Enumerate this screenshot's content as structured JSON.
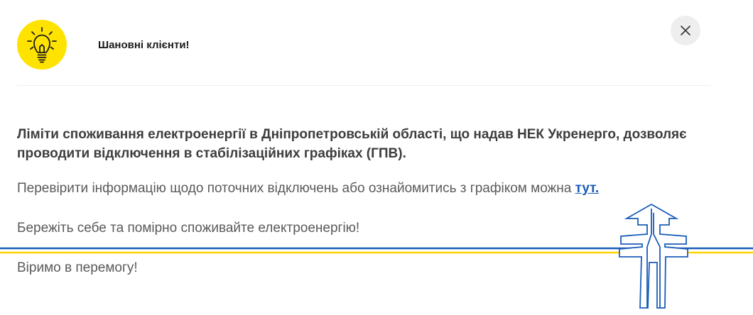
{
  "header": {
    "title": "Шановні клієнти!",
    "icon": "lightbulb-icon",
    "icon_bg": "#ffe300"
  },
  "close": {
    "icon": "close-icon"
  },
  "content": {
    "lead": "Ліміти споживання електроенергії в Дніпропетровській області, що надав НЕК Укренерго, дозволяє проводити відключення в стабілізаційних графіках (ГПВ).",
    "check_text": "Перевірити інформацію щодо поточних відключень або ознайомитись з графіком можна ",
    "check_link": "тут.",
    "care": "Бережіть себе та помірно споживайте електроенергію!",
    "victory": "Віримо в перемогу!"
  },
  "colors": {
    "link": "#1a5db8",
    "line_blue": "#1a5db8",
    "line_yellow": "#ffd500"
  },
  "decoration": {
    "icon": "power-pylon-icon"
  }
}
